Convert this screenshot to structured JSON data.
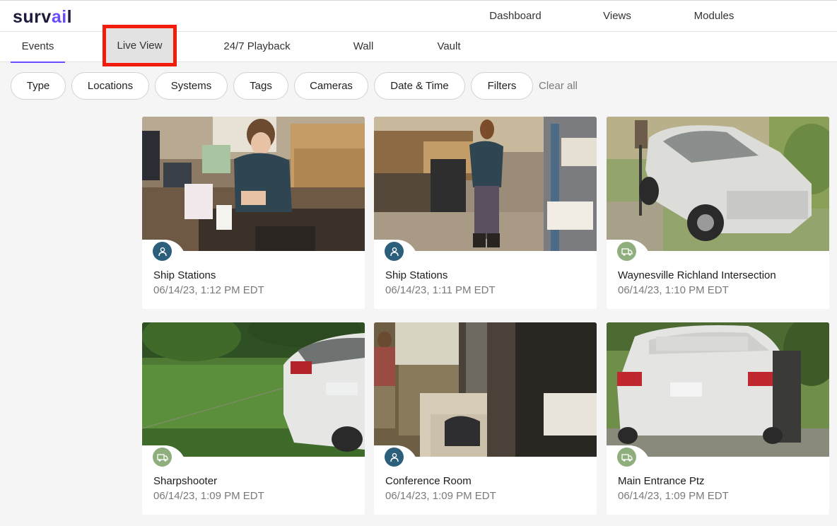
{
  "app": {
    "logo_primary": "surv",
    "logo_accent": "ai",
    "logo_suffix": "l"
  },
  "top_nav": [
    {
      "label": "Dashboard",
      "active": false
    },
    {
      "label": "Views",
      "active": true
    },
    {
      "label": "Modules",
      "active": false
    }
  ],
  "sub_nav": [
    {
      "label": "Events",
      "active": true
    },
    {
      "label": "Live View",
      "highlighted": true
    },
    {
      "label": "24/7 Playback"
    },
    {
      "label": "Wall"
    },
    {
      "label": "Vault"
    }
  ],
  "filters": [
    "Type",
    "Locations",
    "Systems",
    "Tags",
    "Cameras",
    "Date & Time",
    "Filters"
  ],
  "clear_all": "Clear all",
  "events": [
    {
      "title": "Ship Stations",
      "time": "06/14/23, 1:12 PM EDT",
      "type_icon": "person-icon",
      "scene": "office-desk"
    },
    {
      "title": "Ship Stations",
      "time": "06/14/23, 1:11 PM EDT",
      "type_icon": "person-icon",
      "scene": "warehouse"
    },
    {
      "title": "Waynesville Richland Intersection",
      "time": "06/14/23, 1:10 PM EDT",
      "type_icon": "vehicle-icon",
      "scene": "suv-driveway"
    },
    {
      "title": "Sharpshooter",
      "time": "06/14/23, 1:09 PM EDT",
      "type_icon": "vehicle-icon",
      "scene": "car-grass"
    },
    {
      "title": "Conference Room",
      "time": "06/14/23, 1:09 PM EDT",
      "type_icon": "person-icon",
      "scene": "conference-room"
    },
    {
      "title": "Main Entrance Ptz",
      "time": "06/14/23, 1:09 PM EDT",
      "type_icon": "vehicle-icon",
      "scene": "delivery-car"
    }
  ],
  "colors": {
    "accent": "#6a4cff",
    "highlight_box": "#f21c0b",
    "person_badge": "#2c5f7c",
    "vehicle_badge": "#8fae7d"
  }
}
